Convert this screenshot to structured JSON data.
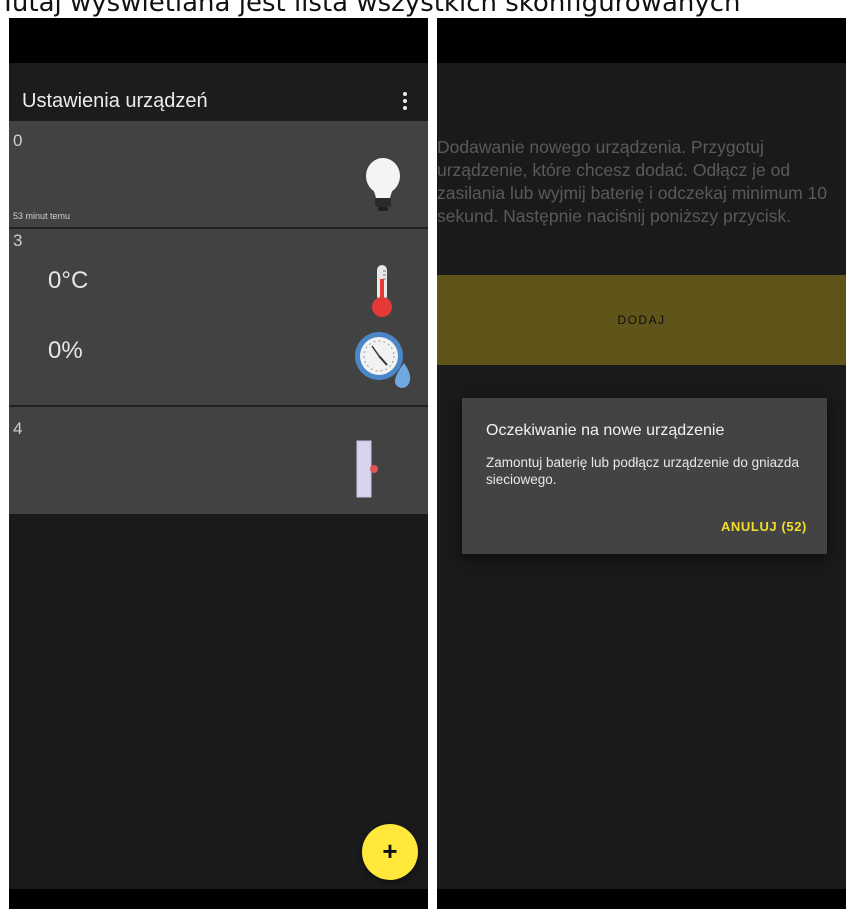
{
  "caption": "Tutaj wyświetlana jest lista wszystkich skonfigurowanych",
  "left_screen": {
    "app_title": "Ustawienia urządzeń",
    "menu_icon": "more-vert-icon",
    "devices": [
      {
        "id": "0",
        "time": "53 minut temu",
        "icon": "light-bulb-icon"
      },
      {
        "id": "3",
        "temperature": "0°C",
        "humidity": "0%",
        "icons": [
          "thermometer-icon",
          "humidity-gauge-icon"
        ]
      },
      {
        "id": "4",
        "icon": "door-sensor-icon"
      }
    ],
    "fab_label": "+",
    "colors": {
      "fab": "#ffe83a",
      "card": "#424242",
      "background": "#1a1a1a"
    }
  },
  "right_screen": {
    "instructions": "Dodawanie nowego urządzenia. Przygotuj urządzenie, które chcesz dodać. Odłącz je od zasilania lub wyjmij baterię i odczekaj minimum 10 sekund. Następnie naciśnij poniższy przycisk.",
    "add_button": "DODAJ",
    "dialog": {
      "title": "Oczekiwanie na nowe urządzenie",
      "message": "Zamontuj baterię lub podłącz urządzenie do gniazda sieciowego.",
      "action": "ANULUJ (52)"
    },
    "colors": {
      "add_button": "#5f551b",
      "dialog": "#434343",
      "action": "#f2dd2c"
    }
  }
}
